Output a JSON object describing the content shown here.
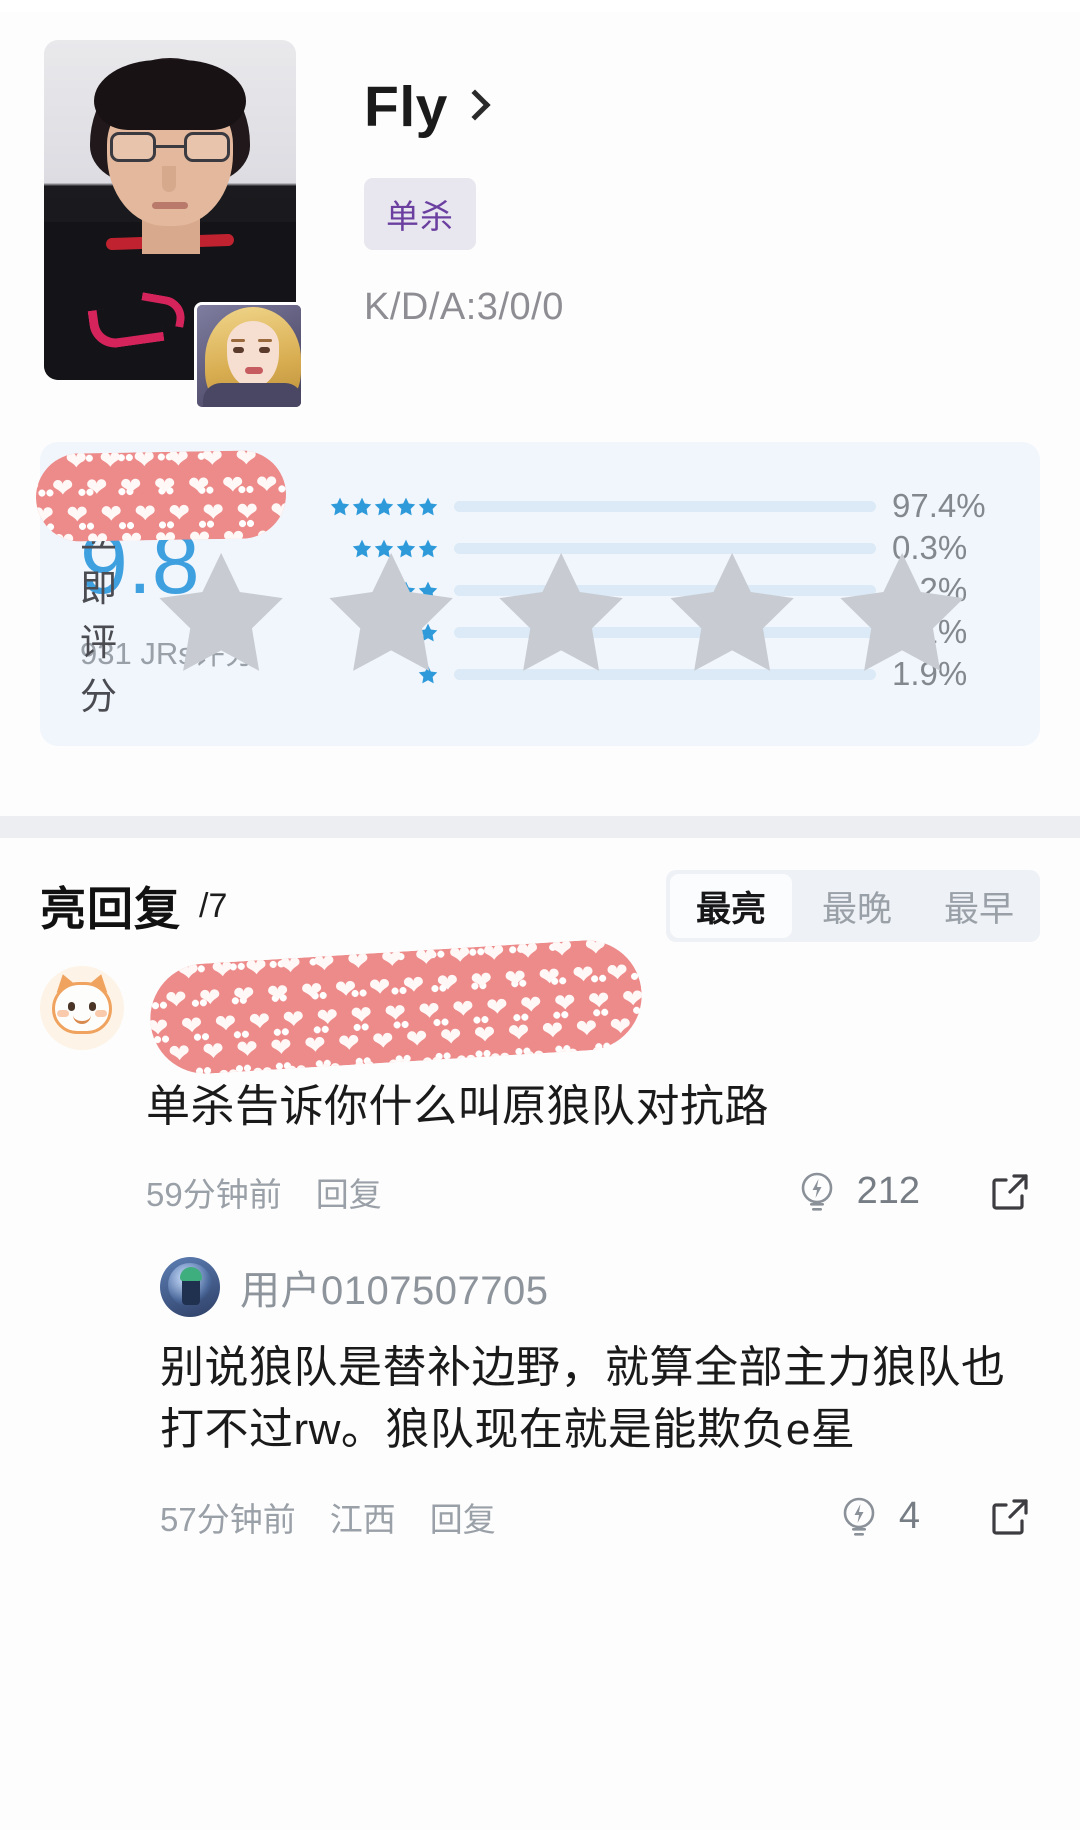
{
  "player": {
    "name": "Fly",
    "name_chevron_icon": "chevron-right-icon",
    "badge": "单杀",
    "kda": "K/D/A:3/0/0",
    "portrait_alt": "player-portrait",
    "hero_alt": "hero-avatar"
  },
  "rating": {
    "score": "9.8",
    "voters": "931 JRs评分",
    "rate_now_label": "立即评分",
    "rate_now_stars": 5,
    "distribution": [
      {
        "stars": 5,
        "percent_label": "97.4%",
        "percent": 97.4
      },
      {
        "stars": 4,
        "percent_label": "0.3%",
        "percent": 0.3
      },
      {
        "stars": 3,
        "percent_label": "0.2%",
        "percent": 0.2
      },
      {
        "stars": 2,
        "percent_label": "0.1%",
        "percent": 0.1
      },
      {
        "stars": 1,
        "percent_label": "1.9%",
        "percent": 1.9
      }
    ]
  },
  "replies": {
    "title": "亮回复",
    "count_label": "/7",
    "sort_tabs": [
      {
        "label": "最亮",
        "active": true
      },
      {
        "label": "最晚",
        "active": false
      },
      {
        "label": "最早",
        "active": false
      }
    ],
    "comment": {
      "avatar_icon": "cat-avatar",
      "text": "单杀告诉你什么叫原狼队对抗路",
      "time": "59分钟前",
      "reply_label": "回复",
      "like_icon": "bulb-icon",
      "like_count": "212",
      "share_icon": "share-external-icon",
      "nested": {
        "avatar_icon": "user-avatar",
        "username": "用户0107507705",
        "text": "别说狼队是替补边野，就算全部主力狼队也打不过rw。狼队现在就是能欺负e星",
        "time": "57分钟前",
        "location": "江西",
        "reply_label": "回复",
        "like_icon": "bulb-icon",
        "like_count": "4",
        "share_icon": "share-external-icon"
      }
    }
  },
  "colors": {
    "accent_blue": "#2f9ada",
    "score_blue": "#3fa0e0",
    "badge_purple": "#6b3fa0",
    "card_bg": "#f1f6fc",
    "redact_pink": "#ed8a8a"
  }
}
